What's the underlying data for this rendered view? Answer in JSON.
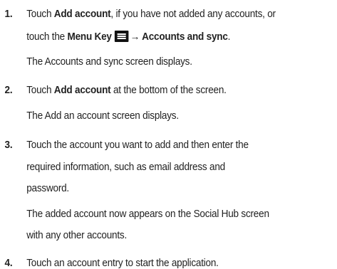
{
  "steps": [
    {
      "number": "1.",
      "line1_part1": "Touch ",
      "line1_bold": "Add account",
      "line1_part2": ", if you have not added any accounts, or",
      "line2_part1": "touch the ",
      "line2_bold1": "Menu Key",
      "menu_key_icon": "menu-key-icon",
      "line2_bold2": "→ Accounts and sync",
      "line2_end": ".",
      "result": "The Accounts and sync screen displays."
    },
    {
      "number": "2.",
      "line1_part1": "Touch ",
      "line1_bold": "Add account",
      "line1_part2": " at the bottom of the screen.",
      "result": "The Add an account screen displays."
    },
    {
      "number": "3.",
      "line1": "Touch the account you want to add and then enter the",
      "line2": "required information, such as email address and",
      "line3": "password.",
      "result_line1": "The added account now appears on the Social Hub screen",
      "result_line2": "with any other accounts."
    },
    {
      "number": "4.",
      "line1": "Touch an account entry to start the application."
    }
  ]
}
